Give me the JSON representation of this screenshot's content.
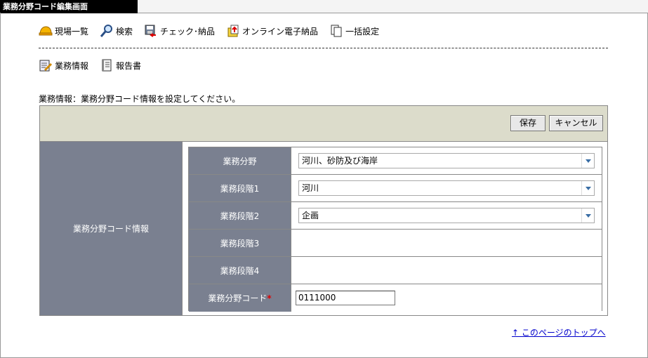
{
  "window": {
    "title": "業務分野コード編集画面"
  },
  "toolbar": {
    "items": [
      {
        "label": "現場一覧",
        "icon": "helmet-icon"
      },
      {
        "label": "検索",
        "icon": "magnifier-icon"
      },
      {
        "label": "チェック･納品",
        "icon": "disk-check-icon"
      },
      {
        "label": "オンライン電子納品",
        "icon": "online-delivery-icon"
      },
      {
        "label": "一括設定",
        "icon": "copy-pages-icon"
      }
    ]
  },
  "subnav": {
    "items": [
      {
        "label": "業務情報",
        "icon": "edit-document-icon"
      },
      {
        "label": "報告書",
        "icon": "report-icon"
      }
    ]
  },
  "message": "業務情報：業務分野コード情報を設定してください。",
  "panel": {
    "save_label": "保存",
    "cancel_label": "キャンセル",
    "section_label": "業務分野コード情報",
    "rows": [
      {
        "label": "業務分野",
        "type": "select",
        "value": "河川、砂防及び海岸"
      },
      {
        "label": "業務段階1",
        "type": "select",
        "value": "河川"
      },
      {
        "label": "業務段階2",
        "type": "select",
        "value": "企画"
      },
      {
        "label": "業務段階3",
        "type": "empty",
        "value": ""
      },
      {
        "label": "業務段階4",
        "type": "empty",
        "value": ""
      },
      {
        "label": "業務分野コード",
        "required_mark": "*",
        "type": "input",
        "value": "0111000"
      }
    ]
  },
  "footer": {
    "top_link": "↑ このページのトップへ"
  },
  "colors": {
    "label_bg": "#7a8090",
    "header_bg": "#dcdccb",
    "link": "#0000cc",
    "required": "#e00000"
  }
}
